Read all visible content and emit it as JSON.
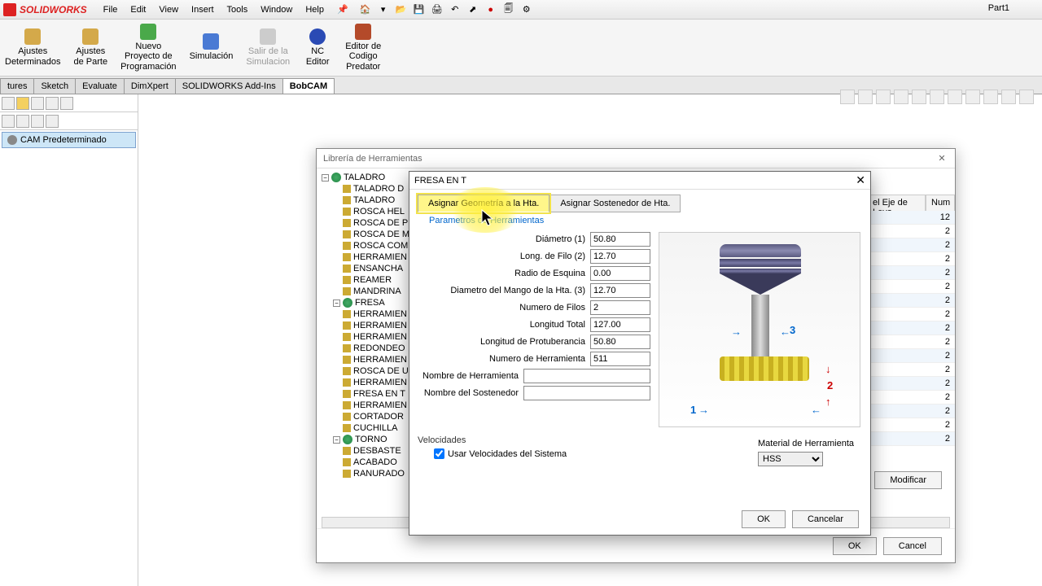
{
  "app": {
    "brand": "SOLIDWORKS",
    "doc_title": "Part1"
  },
  "menus": [
    "File",
    "Edit",
    "View",
    "Insert",
    "Tools",
    "Window",
    "Help"
  ],
  "ribbon": [
    {
      "label": "Ajustes\nDeterminados"
    },
    {
      "label": "Ajustes\nde Parte"
    },
    {
      "label": "Nuevo\nProyecto de\nProgramación"
    },
    {
      "label": "Simulación"
    },
    {
      "label": "Salir de la\nSimulacion",
      "disabled": true
    },
    {
      "label": "NC\nEditor"
    },
    {
      "label": "Editor de\nCodigo\nPredator"
    }
  ],
  "tabs": [
    "tures",
    "Sketch",
    "Evaluate",
    "DimXpert",
    "SOLIDWORKS Add-Ins",
    "BobCAM"
  ],
  "active_tab": "BobCAM",
  "left_item": "CAM Predeterminado",
  "library": {
    "title": "Librería de Herramientas",
    "tree": {
      "taladro": {
        "label": "TALADRO",
        "children": [
          "TALADRO D",
          "TALADRO",
          "ROSCA HEL",
          "ROSCA DE P",
          "ROSCA DE M",
          "ROSCA COM",
          "HERRAMIEN",
          "ENSANCHA",
          "REAMER",
          "MANDRINA"
        ]
      },
      "fresa": {
        "label": "FRESA",
        "children": [
          "HERRAMIEN",
          "HERRAMIEN",
          "HERRAMIEN",
          "REDONDEO",
          "HERRAMIEN",
          "ROSCA DE U",
          "HERRAMIEN",
          "FRESA EN T",
          "HERRAMIEN",
          "CORTADOR",
          "CUCHILLA"
        ]
      },
      "torno": {
        "label": "TORNO",
        "children": [
          "DESBASTE",
          "ACABADO",
          "RANURADO"
        ]
      }
    },
    "columns": {
      "eje": "el Eje de Leva",
      "num": "Num"
    },
    "rows": [
      12,
      2,
      2,
      2,
      2,
      2,
      2,
      2,
      2,
      2,
      2,
      2,
      2,
      2,
      2,
      2,
      2
    ],
    "ok": "OK",
    "cancel": "Cancel",
    "modify": "Modificar"
  },
  "tool": {
    "title": "FRESA EN T",
    "tab_geom": "Asignar Geometría a la Hta.",
    "tab_holder": "Asignar Sostenedor de Hta.",
    "tab_params": "Parametros de Herramientas",
    "fields": {
      "diametro": {
        "label": "Diámetro (1)",
        "value": "50.80"
      },
      "long_filo": {
        "label": "Long. de Filo (2)",
        "value": "12.70"
      },
      "radio": {
        "label": "Radio de Esquina",
        "value": "0.00"
      },
      "mango": {
        "label": "Diametro del Mango de la Hta. (3)",
        "value": "12.70"
      },
      "filos": {
        "label": "Numero de Filos",
        "value": "2"
      },
      "long_total": {
        "label": "Longitud Total",
        "value": "127.00"
      },
      "protuber": {
        "label": "Longitud de Protuberancia",
        "value": "50.80"
      },
      "num_herr": {
        "label": "Numero de Herramienta",
        "value": "511"
      },
      "nombre_herr": {
        "label": "Nombre de Herramienta",
        "value": ""
      },
      "nombre_sost": {
        "label": "Nombre del Sostenedor",
        "value": ""
      }
    },
    "velocidades_label": "Velocidades",
    "usar_vel": "Usar Velocidades del Sistema",
    "material_label": "Material de Herramienta",
    "material_value": "HSS",
    "ok": "OK",
    "cancel": "Cancelar"
  }
}
